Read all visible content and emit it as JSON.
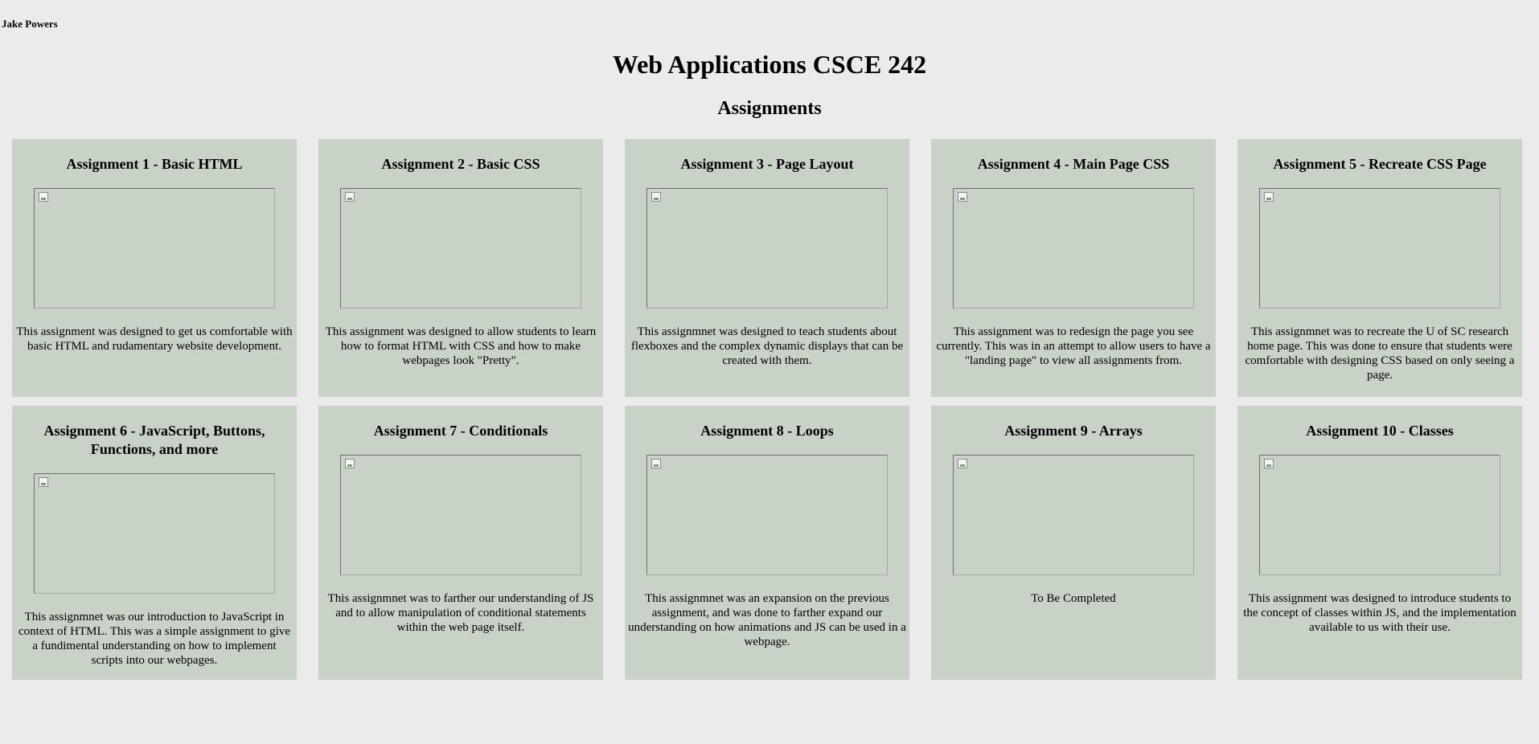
{
  "author": "Jake Powers",
  "site_title": "Web Applications CSCE 242",
  "section_title": "Assignments",
  "assignments": [
    {
      "title": "Assignment 1 - Basic HTML",
      "description": "This assignment was designed to get us comfortable with basic HTML and rudamentary website development."
    },
    {
      "title": "Assignment 2 - Basic CSS",
      "description": "This assignment was designed to allow students to learn how to format HTML with CSS and how to make webpages look \"Pretty\"."
    },
    {
      "title": "Assignment 3 - Page Layout",
      "description": "This assignmnet was designed to teach students about flexboxes and the complex dynamic displays that can be created with them."
    },
    {
      "title": "Assignment 4 - Main Page CSS",
      "description": "This assignment was to redesign the page you see currently. This was in an attempt to allow users to have a \"landing page\" to view all assignments from."
    },
    {
      "title": "Assignment 5 - Recreate CSS Page",
      "description": "This assignmnet was to recreate the U of SC research home page. This was done to ensure that students were comfortable with designing CSS based on only seeing a page."
    },
    {
      "title": "Assignment 6 - JavaScript, Buttons, Functions, and more",
      "description": "This assignmnet was our introduction to JavaScript in context of HTML. This was a simple assignment to give a fundimental understanding on how to implement scripts into our webpages."
    },
    {
      "title": "Assignment 7 - Conditionals",
      "description": "This assignmnet was to farther our understanding of JS and to allow manipulation of conditional statements within the web page itself."
    },
    {
      "title": "Assignment 8 - Loops",
      "description": "This assignmnet was an expansion on the previous assignment, and was done to farther expand our understanding on how animations and JS can be used in a webpage."
    },
    {
      "title": "Assignment 9 - Arrays",
      "description": "To Be Completed"
    },
    {
      "title": "Assignment 10 - Classes",
      "description": "This assignment was designed to introduce students to the concept of classes within JS, and the implementation available to us with their use."
    }
  ],
  "icons": {
    "thumbnail": "broken-image-icon"
  },
  "colors": {
    "page_background": "#ebebeb",
    "card_background": "#c9d2c6"
  }
}
